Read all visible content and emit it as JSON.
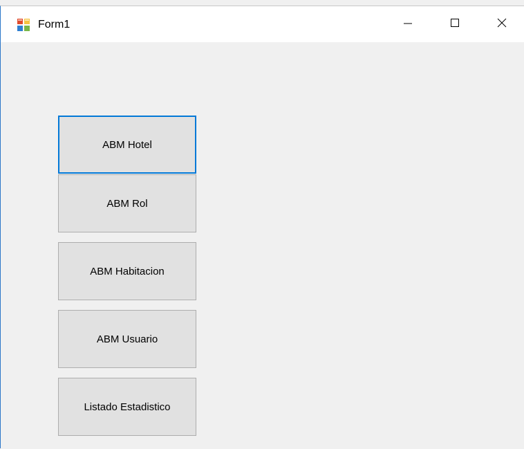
{
  "window": {
    "title": "Form1"
  },
  "titlebar": {
    "icons": {
      "app": "form-app-icon",
      "minimize": "minimize-icon",
      "maximize": "maximize-icon",
      "close": "close-icon"
    }
  },
  "menu_buttons": [
    {
      "label": "ABM Hotel",
      "focused": true
    },
    {
      "label": "ABM Rol",
      "focused": false
    },
    {
      "label": "ABM Habitacion",
      "focused": false
    },
    {
      "label": "ABM Usuario",
      "focused": false
    },
    {
      "label": "Listado Estadistico",
      "focused": false
    }
  ],
  "colors": {
    "focus_border": "#0078d7",
    "button_face": "#e1e1e1",
    "button_border": "#adadad",
    "client_background": "#f0f0f0",
    "titlebar_background": "#ffffff"
  }
}
